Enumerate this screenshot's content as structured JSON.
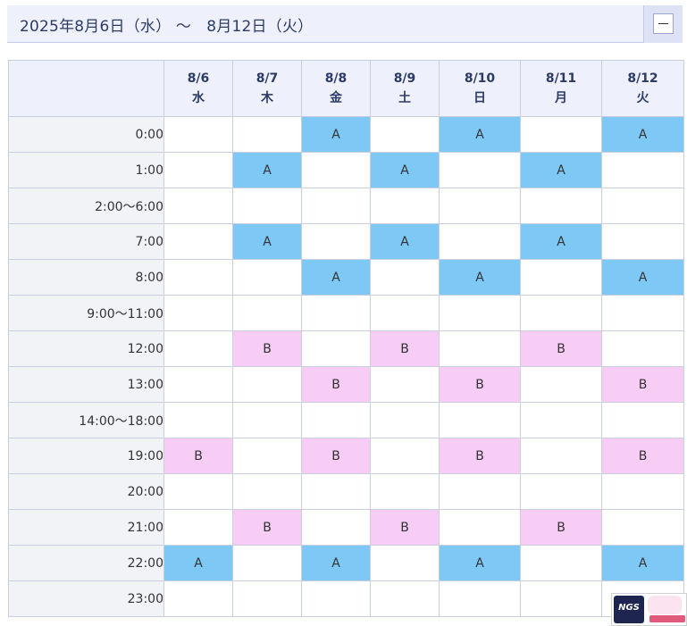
{
  "header": {
    "title": "2025年8月6日（水） ～　8月12日（火）"
  },
  "days": [
    {
      "date": "8/6",
      "weekday": "水"
    },
    {
      "date": "8/7",
      "weekday": "木"
    },
    {
      "date": "8/8",
      "weekday": "金"
    },
    {
      "date": "8/9",
      "weekday": "土"
    },
    {
      "date": "8/10",
      "weekday": "日"
    },
    {
      "date": "8/11",
      "weekday": "月"
    },
    {
      "date": "8/12",
      "weekday": "火"
    }
  ],
  "rows": [
    {
      "time": "0:00",
      "cells": [
        "",
        "",
        "A",
        "",
        "A",
        "",
        "A"
      ]
    },
    {
      "time": "1:00",
      "cells": [
        "",
        "A",
        "",
        "A",
        "",
        "A",
        ""
      ]
    },
    {
      "time": "2:00～6:00",
      "cells": [
        "",
        "",
        "",
        "",
        "",
        "",
        ""
      ]
    },
    {
      "time": "7:00",
      "cells": [
        "",
        "A",
        "",
        "A",
        "",
        "A",
        ""
      ]
    },
    {
      "time": "8:00",
      "cells": [
        "",
        "",
        "A",
        "",
        "A",
        "",
        "A"
      ]
    },
    {
      "time": "9:00～11:00",
      "cells": [
        "",
        "",
        "",
        "",
        "",
        "",
        ""
      ]
    },
    {
      "time": "12:00",
      "cells": [
        "",
        "B",
        "",
        "B",
        "",
        "B",
        ""
      ]
    },
    {
      "time": "13:00",
      "cells": [
        "",
        "",
        "B",
        "",
        "B",
        "",
        "B"
      ]
    },
    {
      "time": "14:00～18:00",
      "cells": [
        "",
        "",
        "",
        "",
        "",
        "",
        ""
      ]
    },
    {
      "time": "19:00",
      "cells": [
        "B",
        "",
        "B",
        "",
        "B",
        "",
        "B"
      ]
    },
    {
      "time": "20:00",
      "cells": [
        "",
        "",
        "",
        "",
        "",
        "",
        ""
      ]
    },
    {
      "time": "21:00",
      "cells": [
        "",
        "B",
        "",
        "B",
        "",
        "B",
        ""
      ]
    },
    {
      "time": "22:00",
      "cells": [
        "A",
        "",
        "A",
        "",
        "A",
        "",
        "A"
      ]
    },
    {
      "time": "23:00",
      "cells": [
        "",
        "",
        "",
        "",
        "",
        "",
        ""
      ]
    }
  ],
  "colors": {
    "A": "#7ec8f6",
    "B": "#f8cdf5",
    "header_bg": "#eef1fb",
    "time_bg": "#f1f3f7"
  },
  "logos": {
    "ngs": "NGS"
  }
}
